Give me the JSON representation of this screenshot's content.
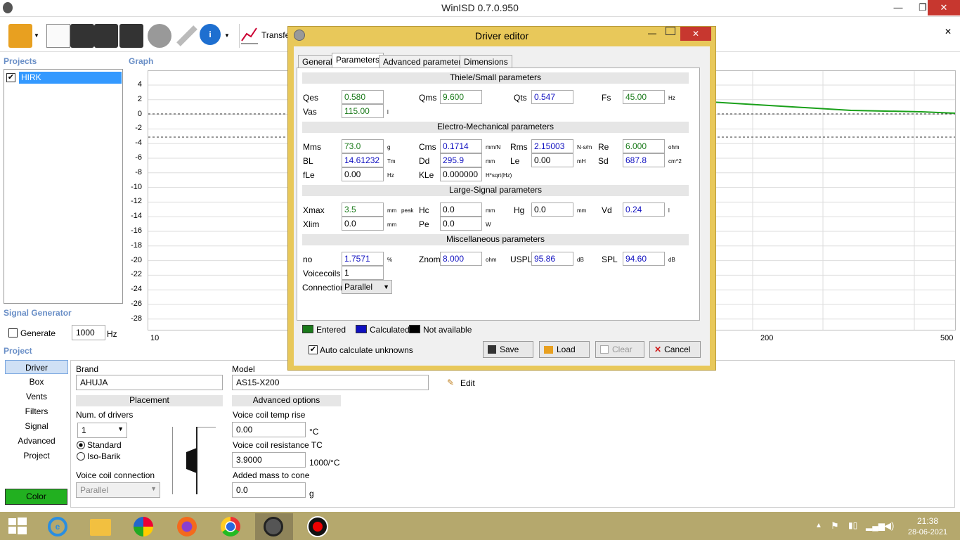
{
  "window": {
    "title": "WinISD 0.7.0.950",
    "min": "—",
    "max": "❐",
    "close": "✕",
    "close2": "✕"
  },
  "toolbar": {
    "transfer_label": "Transfe"
  },
  "projects": {
    "heading": "Projects",
    "items": [
      "HIRK"
    ]
  },
  "graph": {
    "heading": "Graph",
    "y_ticks": [
      "4",
      "2",
      "0",
      "-2",
      "-4",
      "-6",
      "-8",
      "-10",
      "-12",
      "-14",
      "-16",
      "-18",
      "-20",
      "-22",
      "-24",
      "-26",
      "-28"
    ],
    "x_ticks": [
      "10",
      "200",
      "500"
    ]
  },
  "signal": {
    "heading": "Signal Generator",
    "generate_label": "Generate",
    "freq": "1000",
    "unit": "Hz"
  },
  "project": {
    "heading": "Project",
    "nav": [
      "Driver",
      "Box",
      "Vents",
      "Filters",
      "Signal",
      "Advanced",
      "Project"
    ],
    "color_btn": "Color"
  },
  "driverpanel": {
    "brand_label": "Brand",
    "brand": "AHUJA",
    "model_label": "Model",
    "model": "AS15-X200",
    "edit": "Edit",
    "placement": "Placement",
    "num_drivers_label": "Num. of drivers",
    "num_drivers": "1",
    "standard": "Standard",
    "isobarik": "Iso-Barik",
    "vc_conn_label": "Voice coil connection",
    "vc_conn": "Parallel",
    "advanced": "Advanced options",
    "vc_temp_label": "Voice coil temp rise",
    "vc_temp": "0.00",
    "vc_temp_unit": "°C",
    "vc_res_label": "Voice coil resistance TC",
    "vc_res": "3.9000",
    "vc_res_unit": "1000/°C",
    "mass_label": "Added mass to cone",
    "mass": "0.0",
    "mass_unit": "g"
  },
  "dialog": {
    "title": "Driver editor",
    "tabs": [
      "General",
      "Parameters",
      "Advanced parameters",
      "Dimensions"
    ],
    "ts_header": "Thiele/Small parameters",
    "em_header": "Electro-Mechanical parameters",
    "ls_header": "Large-Signal parameters",
    "misc_header": "Miscellaneous parameters",
    "p": {
      "qes": {
        "l": "Qes",
        "v": "0.580"
      },
      "qms": {
        "l": "Qms",
        "v": "9.600"
      },
      "qts": {
        "l": "Qts",
        "v": "0.547"
      },
      "fs": {
        "l": "Fs",
        "v": "45.00",
        "u": "Hz"
      },
      "vas": {
        "l": "Vas",
        "v": "115.00",
        "u": "l"
      },
      "mms": {
        "l": "Mms",
        "v": "73.0",
        "u": "g"
      },
      "cms": {
        "l": "Cms",
        "v": "0.1714",
        "u": "mm/N"
      },
      "rms": {
        "l": "Rms",
        "v": "2.15003",
        "u": "N·s/m"
      },
      "re": {
        "l": "Re",
        "v": "6.000",
        "u": "ohm"
      },
      "bl": {
        "l": "BL",
        "v": "14.61232",
        "u": "Tm"
      },
      "dd": {
        "l": "Dd",
        "v": "295.9",
        "u": "mm"
      },
      "le": {
        "l": "Le",
        "v": "0.00",
        "u": "mH"
      },
      "sd": {
        "l": "Sd",
        "v": "687.8",
        "u": "cm^2"
      },
      "fle": {
        "l": "fLe",
        "v": "0.00",
        "u": "Hz"
      },
      "kle": {
        "l": "KLe",
        "v": "0.000000",
        "u": "H*sqrt(Hz)"
      },
      "xmax": {
        "l": "Xmax",
        "v": "3.5",
        "u": "mm",
        "u2": "peak"
      },
      "hc": {
        "l": "Hc",
        "v": "0.0",
        "u": "mm"
      },
      "hg": {
        "l": "Hg",
        "v": "0.0",
        "u": "mm"
      },
      "vd": {
        "l": "Vd",
        "v": "0.24",
        "u": "l"
      },
      "xlim": {
        "l": "Xlim",
        "v": "0.0",
        "u": "mm"
      },
      "pe": {
        "l": "Pe",
        "v": "0.0",
        "u": "W"
      },
      "no": {
        "l": "no",
        "v": "1.7571",
        "u": "%"
      },
      "znom": {
        "l": "Znom",
        "v": "8.000",
        "u": "ohm"
      },
      "uspl": {
        "l": "USPL",
        "v": "95.86",
        "u": "dB"
      },
      "spl": {
        "l": "SPL",
        "v": "94.60",
        "u": "dB"
      },
      "voicecoils": {
        "l": "Voicecoils",
        "v": "1"
      },
      "connection": {
        "l": "Connection",
        "v": "Parallel"
      }
    },
    "legend": {
      "entered": "Entered",
      "calculated": "Calculated",
      "na": "Not available"
    },
    "auto_calc": "Auto calculate unknowns",
    "buttons": {
      "save": "Save",
      "load": "Load",
      "clear": "Clear",
      "cancel": "Cancel"
    }
  },
  "taskbar": {
    "time": "21:38",
    "date": "28-06-2021"
  },
  "colors": {
    "entered": "#1a7a1a",
    "calculated": "#1010c0",
    "dialog_frame": "#e8c85a",
    "taskbar": "#b5a86d",
    "curve": "#1aa01a"
  }
}
